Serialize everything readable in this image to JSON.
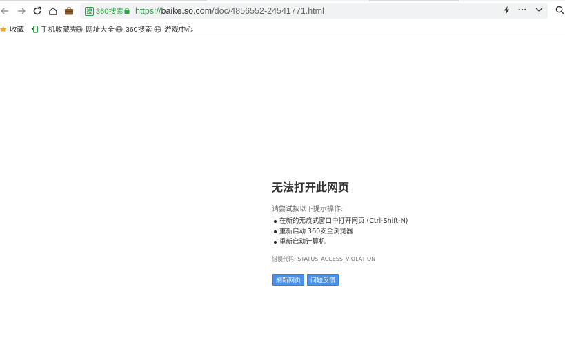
{
  "browser": {
    "site_badge": "360搜索",
    "url": {
      "scheme": "https://",
      "host": "baike.so.com",
      "path": "/doc/4856552-24541771.html"
    },
    "bookmarks": [
      {
        "label": "收藏",
        "icon": "star-icon"
      },
      {
        "label": "手机收藏夹",
        "icon": "phone-icon"
      },
      {
        "label": "网址大全",
        "icon": "globe-icon"
      },
      {
        "label": "360搜索",
        "icon": "globe-icon"
      },
      {
        "label": "游戏中心",
        "icon": "globe-icon"
      }
    ]
  },
  "error_page": {
    "title": "无法打开此网页",
    "hint": "请尝试按以下提示操作:",
    "suggestions": [
      "在新的无痕式窗口中打开网页 (Ctrl-Shift-N)",
      "重新启动 360安全浏览器",
      "重新启动计算机"
    ],
    "error_code": "错误代码:  STATUS_ACCESS_VIOLATION",
    "buttons": {
      "refresh": "刷新网页",
      "feedback": "问题反馈"
    }
  },
  "colors": {
    "accent_green": "#2ba245",
    "button_blue": "#4b91ea",
    "star": "#f5a623"
  }
}
